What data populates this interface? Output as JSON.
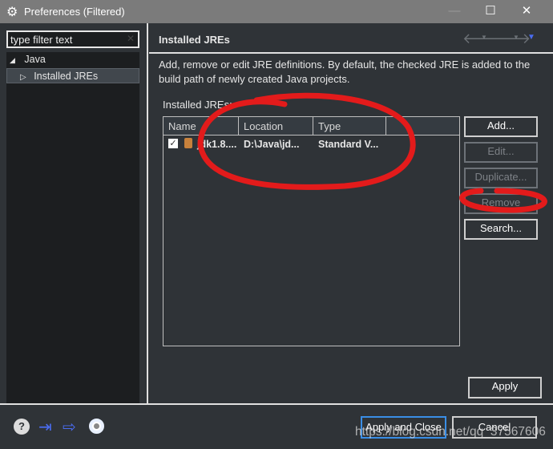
{
  "window": {
    "title": "Preferences (Filtered)",
    "minimize": "—",
    "maximize": "☐",
    "close": "✕"
  },
  "sidebar": {
    "filter_placeholder": "type filter text",
    "filter_value": "type filter text",
    "clear": "✕",
    "items": [
      {
        "label": "Java",
        "expanded": true
      },
      {
        "label": "Installed JREs",
        "selected": true
      }
    ]
  },
  "page": {
    "title": "Installed JREs",
    "description": "Add, remove or edit JRE definitions. By default, the checked JRE is added to the build path of newly created Java projects.",
    "list_label": "Installed JREs:",
    "columns": [
      "Name",
      "Location",
      "Type"
    ],
    "rows": [
      {
        "checked": true,
        "name": "jdk1.8....",
        "location": "D:\\Java\\jd...",
        "type": "Standard V..."
      }
    ],
    "buttons": {
      "add": "Add...",
      "edit": "Edit...",
      "duplicate": "Duplicate...",
      "remove": "Remove",
      "search": "Search...",
      "apply": "Apply"
    }
  },
  "footer": {
    "apply_close": "Apply and Close",
    "cancel": "Cancel"
  },
  "watermark": "https://blog.csdn.net/qq_37567606",
  "colors": {
    "accent": "#4a6cf0",
    "annotation": "#e31b1b"
  }
}
